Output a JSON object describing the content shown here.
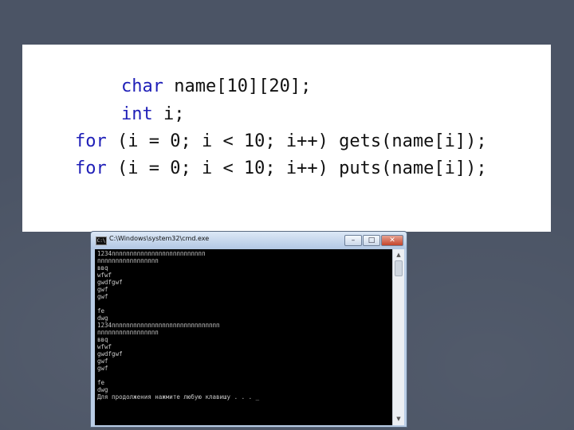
{
  "code": {
    "lines": [
      {
        "kw": "char",
        "rest": " name[10][20];"
      },
      {
        "kw": "int",
        "rest": " i;"
      },
      {
        "kw": "for",
        "rest": " (i = 0; i < 10; i++) gets(name[i]);"
      },
      {
        "kw": "for",
        "rest": " (i = 0; i < 10; i++) puts(name[i]);"
      }
    ]
  },
  "window": {
    "title": "C:\\Windows\\system32\\cmd.exe",
    "icon_text": "C:\\",
    "minimize": "–",
    "maximize": "□",
    "close": "✕"
  },
  "console": {
    "lines": [
      "1234пппппппппппппппппппппппппп",
      "ппппппппппппппппп",
      "ввq",
      "wfwf",
      "gwdfgwf",
      "gwf",
      "gwf",
      "",
      "fe",
      "dwg",
      "1234пппппппппппппппппппппппппппппп",
      "ппппппппппппппппп",
      "ввq",
      "wfwf",
      "gwdfgwf",
      "gwf",
      "gwf",
      "",
      "fe",
      "dwg",
      "Для продолжения нажмите любую клавишу . . . _"
    ]
  },
  "scrollbar": {
    "up_arrow": "▲",
    "down_arrow": "▼"
  },
  "colors": {
    "background": "#4b5465",
    "keyword": "#2020b8",
    "console_bg": "#000000",
    "console_text": "#c8c8c8"
  }
}
